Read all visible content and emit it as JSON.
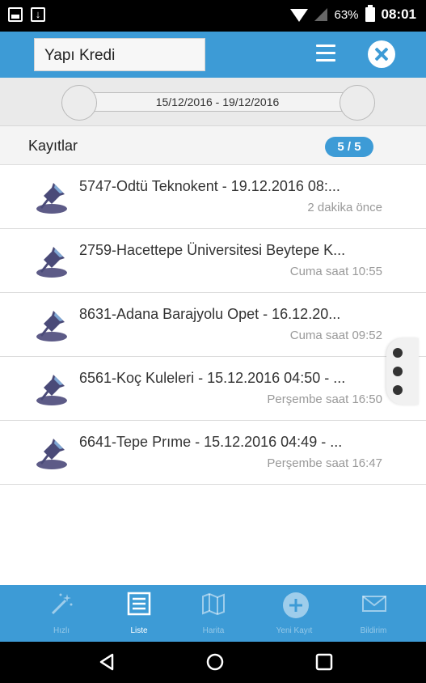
{
  "status_bar": {
    "battery_percent": "63%",
    "time": "08:01",
    "icons": [
      "image-icon",
      "download-icon",
      "wifi-icon",
      "signal-icon",
      "battery-icon"
    ]
  },
  "header": {
    "search_value": "Yapı Kredi",
    "icons": [
      "menu-icon",
      "close-icon"
    ]
  },
  "date_range": {
    "label": "15/12/2016 - 19/12/2016"
  },
  "records": {
    "title": "Kayıtlar",
    "count": "5 / 5"
  },
  "items": [
    {
      "title": "5747-Odtü Teknokent - 19.12.2016 08:...",
      "time": "2 dakika önce"
    },
    {
      "title": "2759-Hacettepe Üniversitesi Beytepe K...",
      "time": "Cuma saat 10:55"
    },
    {
      "title": "8631-Adana Barajyolu Opet - 16.12.20...",
      "time": "Cuma saat 09:52"
    },
    {
      "title": "6561-Koç Kuleleri - 15.12.2016 04:50 - ...",
      "time": "Perşembe saat 16:50"
    },
    {
      "title": "6641-Tepe Prıme - 15.12.2016 04:49 - ...",
      "time": "Perşembe saat 16:47"
    }
  ],
  "tabs": [
    {
      "label": "Hızlı",
      "icon": "magic-wand-icon"
    },
    {
      "label": "Liste",
      "icon": "list-icon"
    },
    {
      "label": "Harita",
      "icon": "map-icon"
    },
    {
      "label": "Yeni Kayıt",
      "icon": "plus-circle-icon"
    },
    {
      "label": "Bildirim",
      "icon": "mail-icon"
    }
  ],
  "colors": {
    "accent": "#3d9bd6",
    "header_bg": "#3d9bd6",
    "badge_bg": "#3d9bd6"
  }
}
